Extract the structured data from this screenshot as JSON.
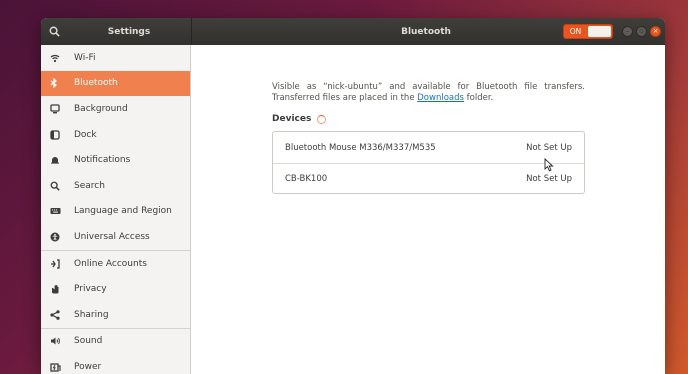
{
  "window": {
    "search_icon": "search-icon",
    "settings_title": "Settings",
    "panel_title": "Bluetooth",
    "bluetooth_switch": {
      "label": "ON",
      "state": "on"
    },
    "window_controls": [
      "minimize-icon",
      "maximize-icon",
      "close-icon"
    ]
  },
  "sidebar": {
    "items": [
      {
        "label": "Wi-Fi",
        "icon": "wifi-icon"
      },
      {
        "label": "Bluetooth",
        "icon": "bluetooth-icon",
        "active": true
      },
      {
        "label": "Background",
        "icon": "background-icon"
      },
      {
        "label": "Dock",
        "icon": "dock-icon"
      },
      {
        "label": "Notifications",
        "icon": "bell-icon"
      },
      {
        "label": "Search",
        "icon": "search-icon"
      },
      {
        "label": "Language and Region",
        "icon": "keyboard-icon"
      },
      {
        "label": "Universal Access",
        "icon": "accessibility-icon"
      },
      {
        "label": "Online Accounts",
        "icon": "online-accounts-icon"
      },
      {
        "label": "Privacy",
        "icon": "hand-icon"
      },
      {
        "label": "Sharing",
        "icon": "share-icon"
      },
      {
        "label": "Sound",
        "icon": "speaker-icon"
      },
      {
        "label": "Power",
        "icon": "power-icon"
      }
    ]
  },
  "main": {
    "description_prefix": "Visible as “nick-ubuntu” and available for Bluetooth file transfers. Transferred files are placed in the",
    "downloads_link": "Downloads",
    "description_suffix": "folder.",
    "devices_label": "Devices",
    "devices": [
      {
        "name": "Bluetooth Mouse M336/M337/M535",
        "status": "Not Set Up"
      },
      {
        "name": "CB-BK100",
        "status": "Not Set Up"
      }
    ]
  },
  "colors": {
    "accent": "#e95420",
    "active_item": "#f0814f",
    "link": "#1c6fbf"
  }
}
